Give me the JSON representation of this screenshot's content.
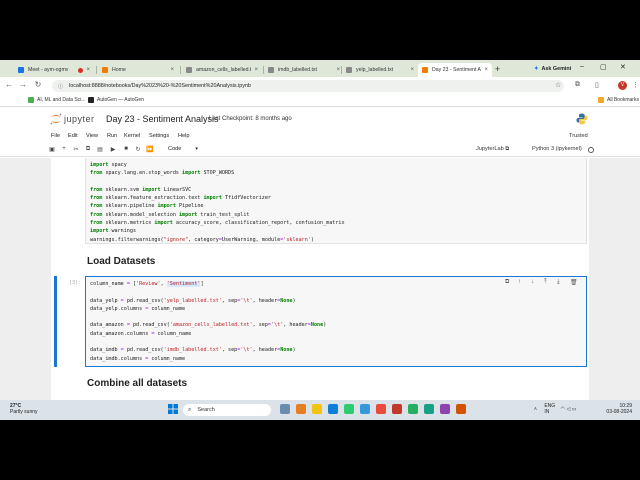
{
  "browser": {
    "tabs": [
      {
        "title": "Meet - aym-ogmv",
        "icon": "meet-icon",
        "color": "#1a73e8"
      },
      {
        "title": "Home",
        "icon": "jupyter-icon",
        "color": "#f57c00"
      },
      {
        "title": "amazon_cells_labelled.t",
        "icon": "doc-icon",
        "color": "#888888"
      },
      {
        "title": "imdb_labelled.txt",
        "icon": "doc-icon",
        "color": "#888888"
      },
      {
        "title": "yelp_labelled.txt",
        "icon": "doc-icon",
        "color": "#888888"
      },
      {
        "title": "Day 23 - Sentiment A",
        "icon": "jupyter-icon",
        "color": "#f57c00"
      }
    ],
    "ask_gemini": "Ask Gemini",
    "url": "localhost:8888/notebooks/Day%2023%20-%20Sentiment%20Analysis.ipynb",
    "profile_initial": "V",
    "bookmarks": [
      {
        "label": "AI, ML and Data Sci...",
        "color": "#4caf50"
      },
      {
        "label": "AutoGen — AutoGen",
        "color": "#222222"
      }
    ],
    "all_bookmarks": "All Bookmarks"
  },
  "jupyter": {
    "brand": "jupyter",
    "notebook_title": "Day 23 - Sentiment Analysis",
    "checkpoint": "Last Checkpoint: 8 months ago",
    "menus": [
      "File",
      "Edit",
      "View",
      "Run",
      "Kernel",
      "Settings",
      "Help"
    ],
    "trusted": "Trusted",
    "cell_type": "Code",
    "jupyterlab_link": "JupyterLab",
    "kernel": "Python 3 (ipykernel)"
  },
  "cells": {
    "imports": {
      "l1": "import spacy",
      "l2": "from spacy.lang.en.stop_words import STOP_WORDS",
      "l3": "from sklearn.svm import LinearSVC",
      "l4": "from sklearn.feature_extraction.text import TfidfVectorizer",
      "l5": "from sklearn.pipeline import Pipeline",
      "l6": "from sklearn.model_selection import train_test_split",
      "l7": "from sklearn.metrics import accuracy_score, classification_report, confusion_matrix",
      "l8": "import warnings",
      "l9": "warnings.filterwarnings(\"ignore\", category=UserWarning, module='sklearn')"
    },
    "heading_load": "Load Datasets",
    "load": {
      "prompt": "[3]:",
      "l1": "column_name = ['Review', 'Sentiment']",
      "l2": "data_yelp = pd.read_csv('yelp_labelled.txt', sep='\\t', header=None)",
      "l3": "data_yelp.columns = column_name",
      "l4": "data_amazon = pd.read_csv('amazon_cells_labelled.txt', sep='\\t', header=None)",
      "l5": "data_amazon.columns = column_name",
      "l6": "data_imdb = pd.read_csv('imdb_labelled.txt', sep='\\t', header=None)",
      "l7": "data_imdb.columns = column_name"
    },
    "heading_combine": "Combine all datasets"
  },
  "taskbar": {
    "temp": "27°C",
    "weather": "Partly sunny",
    "search": "Search",
    "lang1": "ENG",
    "lang2": "IN",
    "time": "10:29",
    "date": "03-08-2024"
  },
  "colors": {
    "accent": "#1976d2",
    "keyword": "#008000",
    "string": "#ba2121"
  }
}
